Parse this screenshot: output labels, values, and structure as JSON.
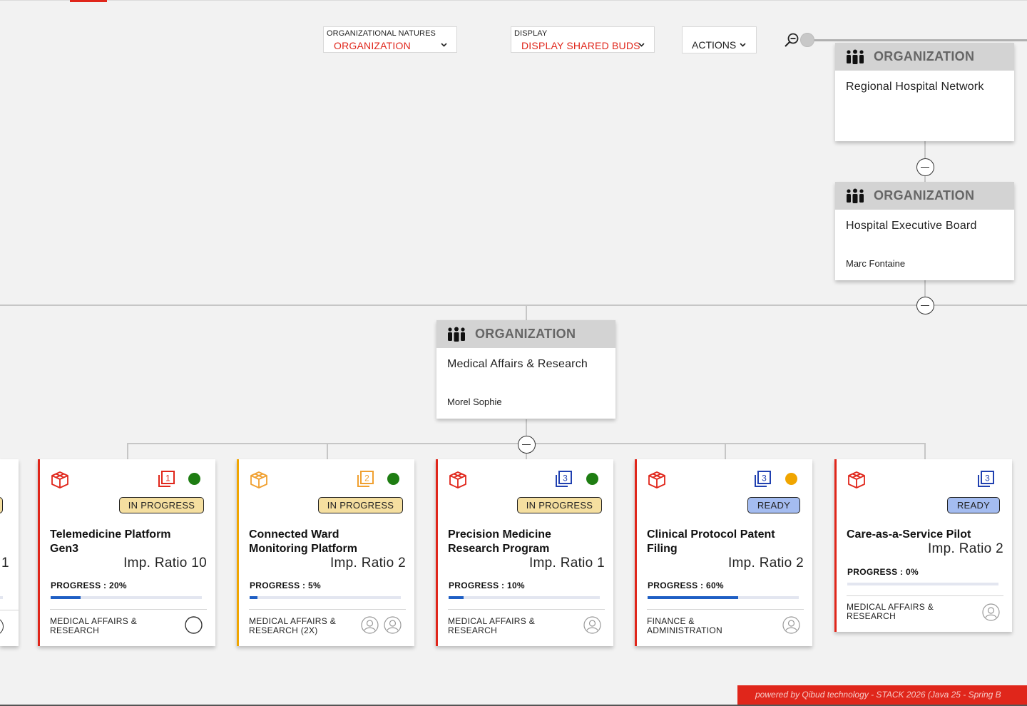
{
  "toolbar": {
    "natures_label": "ORGANIZATIONAL NATURES",
    "natures_value": "ORGANIZATION",
    "display_label": "DISPLAY",
    "display_value": "DISPLAY SHARED BUDS",
    "actions_label": "ACTIONS"
  },
  "org_nodes": [
    {
      "type": "ORGANIZATION",
      "name": "Regional Hospital Network",
      "manager": ""
    },
    {
      "type": "ORGANIZATION",
      "name": "Hospital Executive Board",
      "manager": "Marc Fontaine"
    },
    {
      "type": "ORGANIZATION",
      "name": "Medical Affairs & Research",
      "manager": "Morel Sophie"
    }
  ],
  "partial_card": {
    "ratio_fragment": "1"
  },
  "buds": [
    {
      "level": "1",
      "level_color": "#e0261b",
      "status": "IN PROGRESS",
      "status_dot": "#1e7d12",
      "title": "Telemedicine Platform Gen3",
      "ratio": "Imp. Ratio 10",
      "progress_label": "PROGRESS : 20%",
      "progress": 0.2,
      "organization": "MEDICAL AFFAIRS & RESEARCH",
      "accent": "#e0261b"
    },
    {
      "level": "2",
      "level_color": "#f0a030",
      "status": "IN PROGRESS",
      "status_dot": "#1e7d12",
      "title": "Connected Ward Monitoring Platform",
      "ratio": "Imp. Ratio 2",
      "progress_label": "PROGRESS : 5%",
      "progress": 0.05,
      "organization": "MEDICAL AFFAIRS & RESEARCH (2X)",
      "accent": "#f0a500"
    },
    {
      "level": "3",
      "level_color": "#2040b0",
      "status": "IN PROGRESS",
      "status_dot": "#1e7d12",
      "title": "Precision Medicine Research Program",
      "ratio": "Imp. Ratio 1",
      "progress_label": "PROGRESS : 10%",
      "progress": 0.1,
      "organization": "MEDICAL AFFAIRS & RESEARCH",
      "accent": "#e0261b"
    },
    {
      "level": "3",
      "level_color": "#2040b0",
      "status": "READY",
      "status_dot": "#f0a500",
      "title": "Clinical Protocol Patent Filing",
      "ratio": "Imp. Ratio 2",
      "progress_label": "PROGRESS : 60%",
      "progress": 0.6,
      "organization": "FINANCE & ADMINISTRATION",
      "accent": "#e0261b"
    },
    {
      "level": "3",
      "level_color": "#2040b0",
      "status": "READY",
      "status_dot": "",
      "title": "Care-as-a-Service Pilot",
      "ratio": "Imp. Ratio 2",
      "progress_label": "PROGRESS : 0%",
      "progress": 0.0,
      "organization": "MEDICAL AFFAIRS & RESEARCH",
      "accent": "#e0261b"
    }
  ],
  "footer": {
    "text": "powered by Qibud technology - STACK 2026 (Java 25 - Spring B"
  },
  "colors": {
    "brand": "#e0261b",
    "in_progress_badge": "#f5dfa0",
    "ready_badge": "#a4bcf0",
    "progress_fill": "#1f5fc4"
  }
}
